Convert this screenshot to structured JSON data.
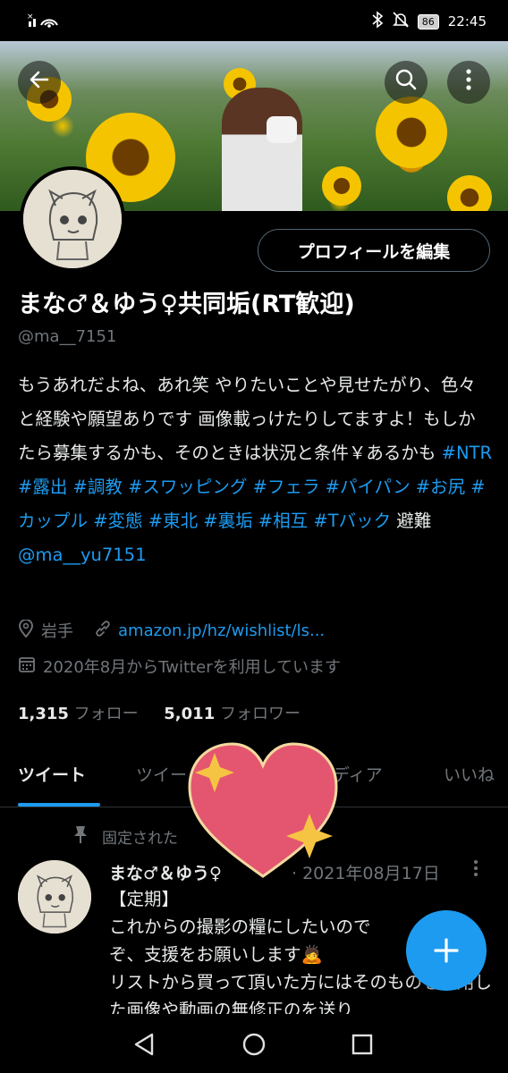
{
  "status_bar": {
    "battery": "86",
    "time": "22:45"
  },
  "profile": {
    "display_name": "まな♂＆ゆう♀共同垢(RT歓迎)",
    "handle": "@ma__7151",
    "edit_button": "プロフィールを編集",
    "bio_parts": [
      {
        "text": "もうあれだよね、あれ笑 やりたいことや見せたがり、色々と経験や願望ありです 画像載っけたりしてますよ！もしかたら募集するかも、そのときは状況と条件￥あるかも ",
        "link": false
      },
      {
        "text": "#NTR #露出 #調教 #スワッピング #フェラ #パイパン #お尻 #カップル #変態 #東北 #裏垢 #相互 #Tバック",
        "link": true
      },
      {
        "text": " 避難 ",
        "link": false
      },
      {
        "text": "@ma__yu7151",
        "link": true
      }
    ],
    "location": "岩手",
    "website": "amazon.jp/hz/wishlist/ls...",
    "joined": "2020年8月からTwitterを利用しています",
    "following_count": "1,315",
    "following_label": "フォロー",
    "followers_count": "5,011",
    "followers_label": "フォロワー"
  },
  "tabs": [
    {
      "label": "ツイート"
    },
    {
      "label": "ツイー"
    },
    {
      "label": "ディア"
    },
    {
      "label": "いいね"
    }
  ],
  "pinned_tweet": {
    "pinned_label": "固定された",
    "author": "まな♂＆ゆう♀",
    "date": "· 2021年08月17日",
    "body": "【定期】\nこれからの撮影の糧にしたいので\nぞ、支援をお願いします🙇\nリストから買って頂いた方にはそのものを利用した画像や動画の無修正のを送り"
  },
  "colors": {
    "accent": "#1d9bf0",
    "background": "#000000",
    "muted": "#71767b"
  },
  "icons": [
    "back-icon",
    "search-icon",
    "more-icon",
    "location-icon",
    "link-icon",
    "calendar-icon",
    "pin-icon",
    "compose-plus-icon",
    "nav-back-icon",
    "nav-home-icon",
    "nav-recents-icon"
  ]
}
